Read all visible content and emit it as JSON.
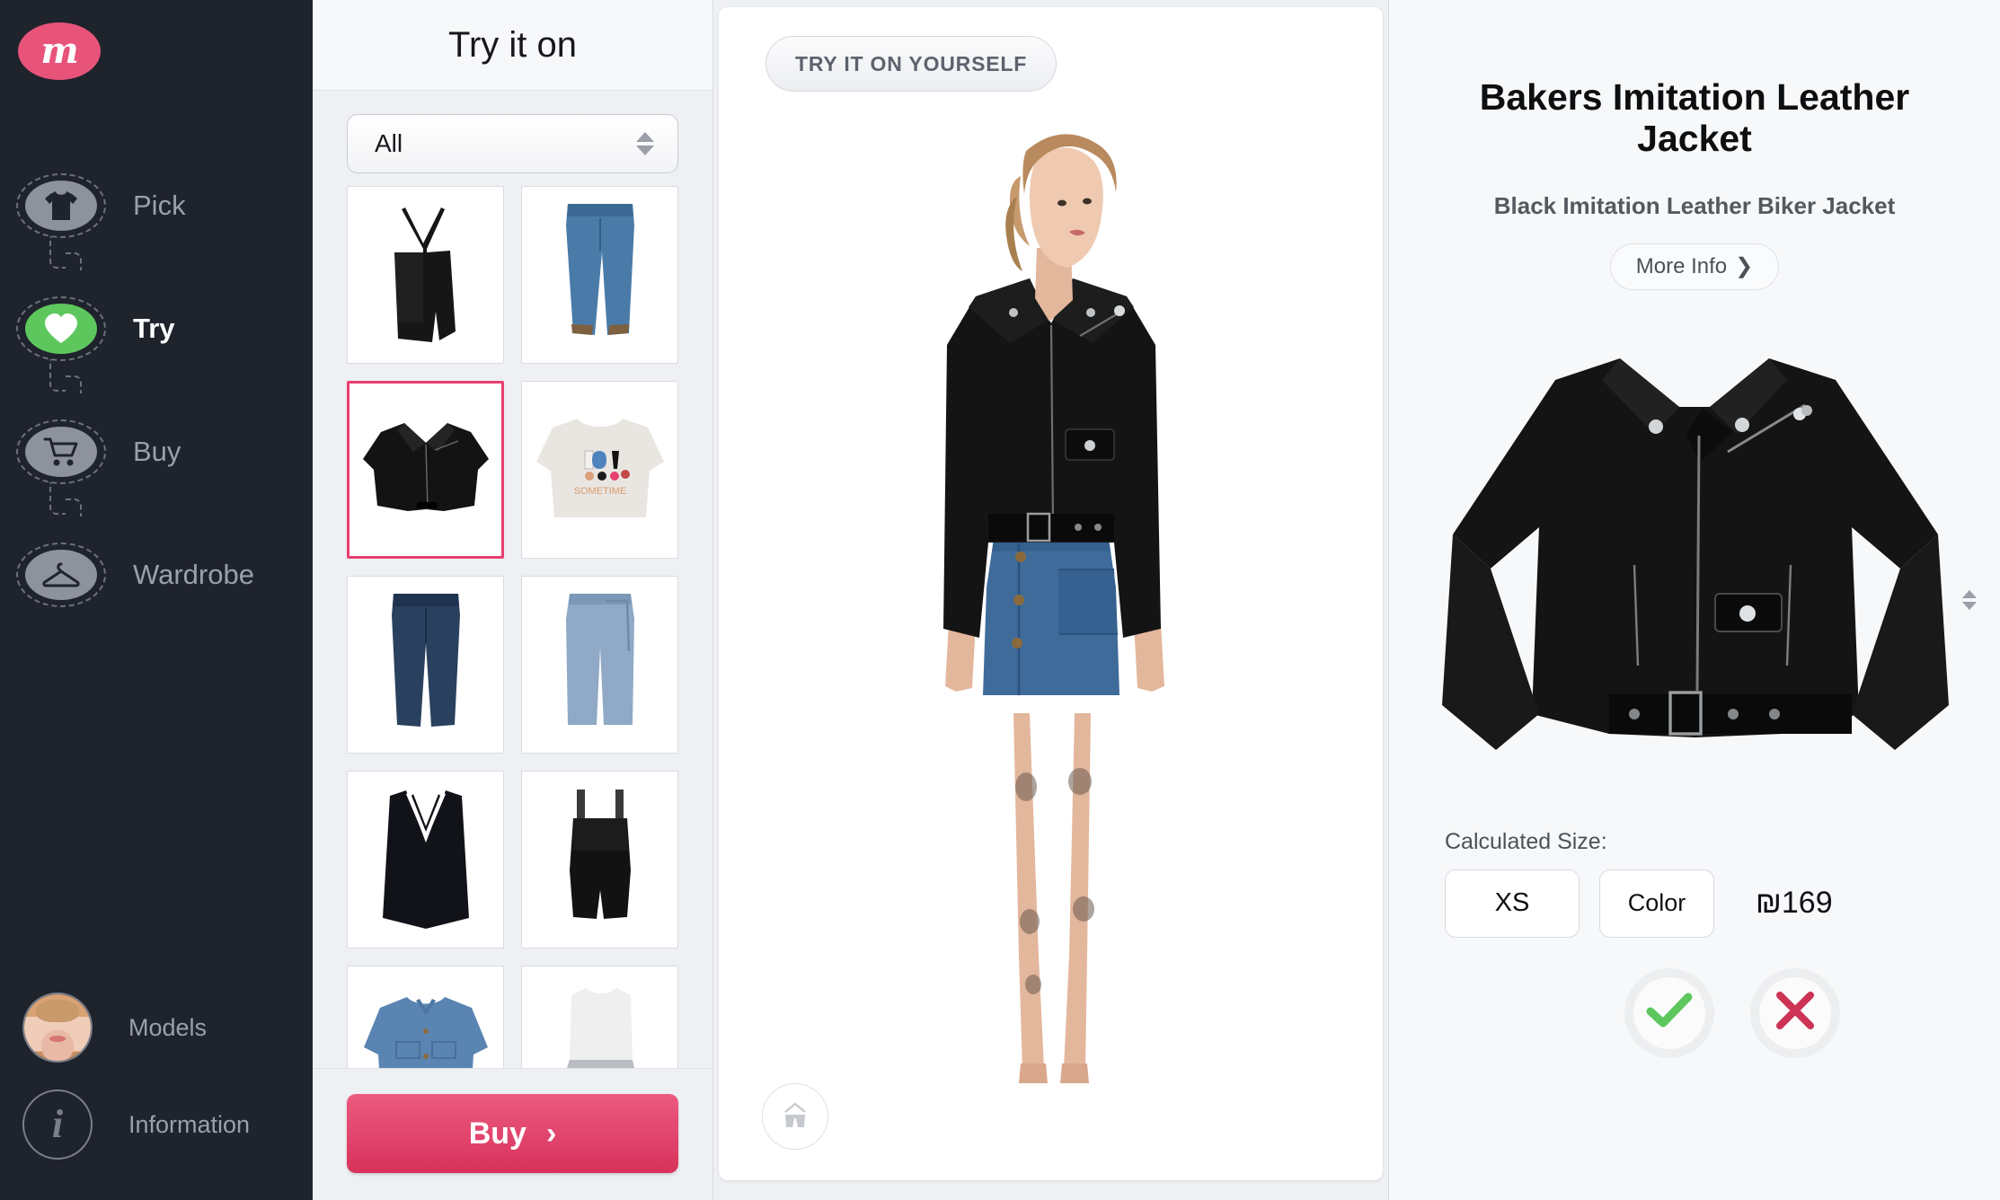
{
  "brand": {
    "logo_letter": "m",
    "logo_color": "#e8537a"
  },
  "sidebar": {
    "steps": [
      {
        "label": "Pick",
        "icon": "tshirt-icon",
        "active": false
      },
      {
        "label": "Try",
        "icon": "heart-icon",
        "active": true
      },
      {
        "label": "Buy",
        "icon": "shopping-cart-icon",
        "active": false
      },
      {
        "label": "Wardrobe",
        "icon": "hanger-icon",
        "active": false
      }
    ],
    "bottom_items": [
      {
        "label": "Models",
        "icon": "avatar-icon"
      },
      {
        "label": "Information",
        "icon": "info-icon"
      }
    ],
    "active_color": "#5dc75d"
  },
  "pick_panel": {
    "title": "Try it on",
    "filter": {
      "value": "All",
      "placeholder": "All",
      "icon": "stepper-icon"
    },
    "buy_button": {
      "label": "Buy",
      "chevron": "›",
      "color": "#e8406f"
    },
    "items": [
      {
        "name": "black-leather-slip-dress",
        "selected": false
      },
      {
        "name": "blue-skinny-jeans",
        "selected": false
      },
      {
        "name": "black-biker-leather-jacket",
        "selected": true
      },
      {
        "name": "white-graphic-sweater",
        "selected": false
      },
      {
        "name": "dark-blue-jeans",
        "selected": false
      },
      {
        "name": "light-blue-wide-leg-trousers",
        "selected": false
      },
      {
        "name": "black-v-neck-dress",
        "selected": false
      },
      {
        "name": "black-strappy-playsuit",
        "selected": false
      },
      {
        "name": "denim-shirt",
        "selected": false
      },
      {
        "name": "white-wrap-top",
        "selected": false
      }
    ]
  },
  "stage": {
    "try_yourself_label": "TRY IT ON YOURSELF",
    "underwear_toggle_icon": "shorts-icon",
    "model_alt": "female-model-wearing-black-biker-jacket-and-denim-skirt"
  },
  "product": {
    "title": "Bakers Imitation Leather Jacket",
    "subtitle": "Black Imitation Leather Biker Jacket",
    "more_info_label": "More Info",
    "more_info_chevron": "❯",
    "image_alt": "black-imitation-leather-biker-jacket",
    "calculated_size_label": "Calculated Size:",
    "size_value": "XS",
    "color_value": "Color",
    "price": "₪169",
    "confirm_icon": "check-icon",
    "reject_icon": "x-icon",
    "confirm_color": "#5dc75d",
    "reject_color": "#cc3355"
  }
}
